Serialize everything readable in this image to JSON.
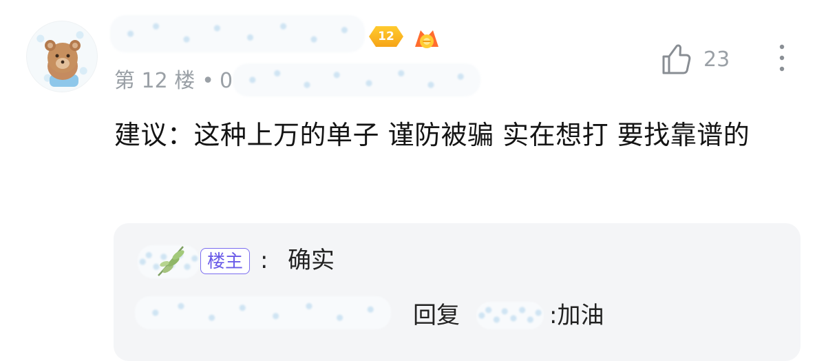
{
  "comment": {
    "level": "12",
    "floor_label": "第 12 楼",
    "separator": "•",
    "time_fragment": "0",
    "likes": "23",
    "text": "建议：这种上万的单子 谨防被骗 实在想打 要找靠谱的"
  },
  "reply": {
    "owner_badge": "楼主",
    "separator": ":",
    "text": "确实",
    "reply_label": "回复",
    "reply_text": ":加油"
  },
  "icons": {
    "level": "level-badge-icon",
    "medal": "medal-icon",
    "like": "thumb-up-icon",
    "more": "more-vertical-icon",
    "leaf": "leaf-icon"
  },
  "colors": {
    "meta_text": "#9aa0a6",
    "owner_badge": "#6a5be8",
    "level_badge": "#f6a417",
    "reply_background": "#f4f5f7"
  }
}
